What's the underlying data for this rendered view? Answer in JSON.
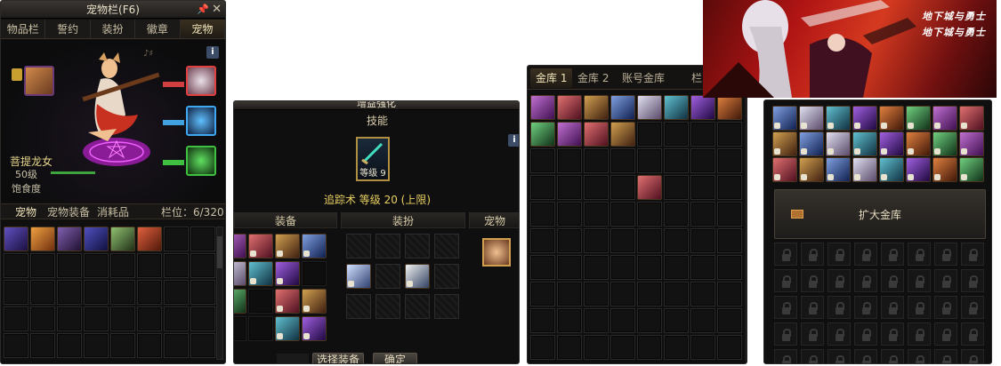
{
  "pet_window": {
    "title": "宠物栏(F6)",
    "tabs": [
      "物品栏",
      "誓约",
      "装扮",
      "徽章",
      "宠物"
    ],
    "pet_name": "菩提龙女",
    "pet_level": "50级",
    "pet_hunger_label": "饱食度",
    "inventory_tabs": [
      "宠物",
      "宠物装备",
      "消耗品"
    ],
    "slot_count": "栏位：6/320",
    "info_icon": "i"
  },
  "enhance_window": {
    "title": "增益强化",
    "skill_header": "技能",
    "skill_level_badge": "等级 9",
    "skill_desc": "追踪术 等级 20 (上限)",
    "sections": [
      "装备",
      "装扮",
      "宠物"
    ],
    "select_button": "选择装备",
    "confirm_button": "确定",
    "info_icon": "i"
  },
  "bank_window": {
    "tabs": [
      "金库 1",
      "金库 2",
      "账号金库",
      "栏"
    ]
  },
  "bank2_window": {
    "expand_button": "扩大金库"
  },
  "banner": {
    "logo_text_1": "地下城与勇士",
    "logo_text_2": "地下城与勇士"
  },
  "colors": {
    "accent_gold": "#f1e4b8",
    "skill_text": "#e8d060",
    "level_text": "#d8ccaa",
    "hunger_bar": "#3ea43e"
  }
}
